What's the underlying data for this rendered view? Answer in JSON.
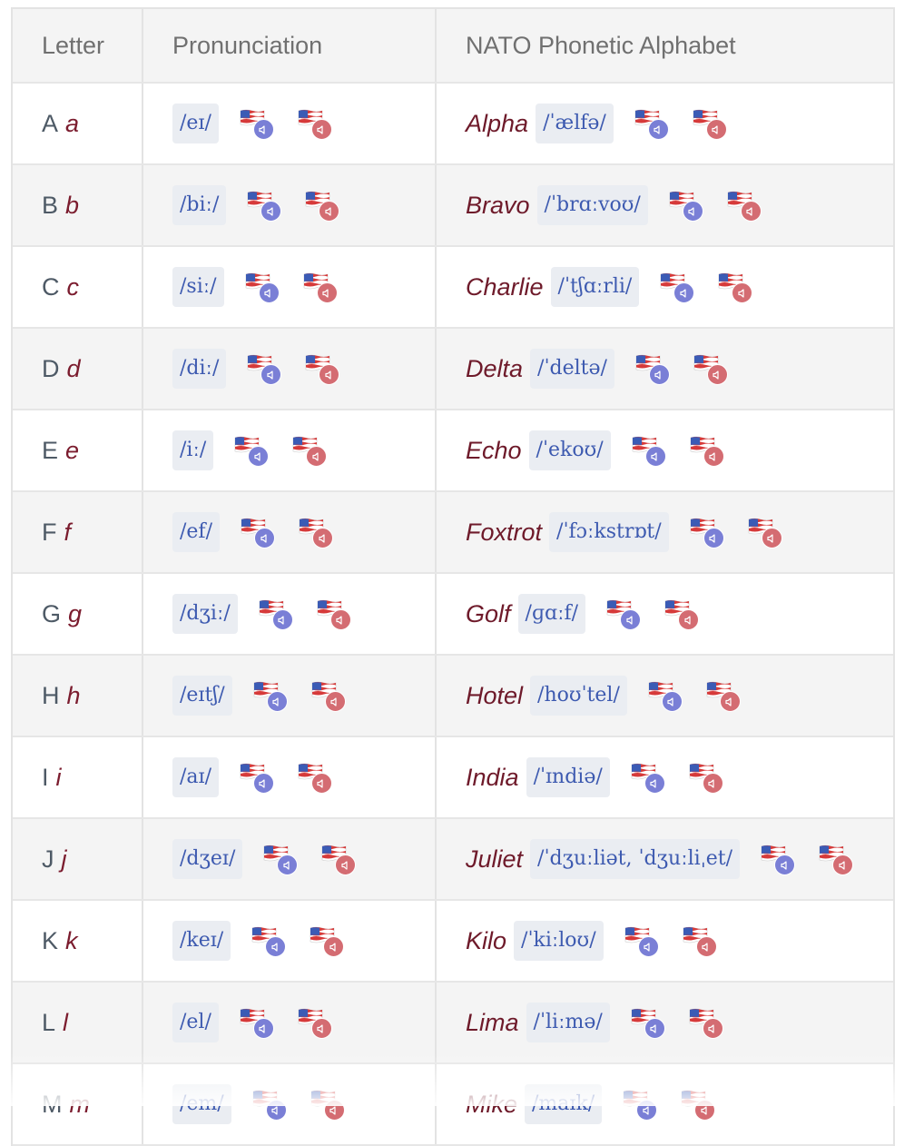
{
  "header": {
    "col_letter": "Letter",
    "col_pronunciation": "Pronunciation",
    "col_nato": "NATO Phonetic Alphabet"
  },
  "rows": [
    {
      "upper": "A",
      "lower": "a",
      "ipa": "/eɪ/",
      "word": "Alpha",
      "word_ipa": "/ˈælfə/"
    },
    {
      "upper": "B",
      "lower": "b",
      "ipa": "/biː/",
      "word": "Bravo",
      "word_ipa": "/ˈbrɑːvoʊ/"
    },
    {
      "upper": "C",
      "lower": "c",
      "ipa": "/siː/",
      "word": "Charlie",
      "word_ipa": "/ˈtʃɑːrli/"
    },
    {
      "upper": "D",
      "lower": "d",
      "ipa": "/diː/",
      "word": "Delta",
      "word_ipa": "/ˈdeltə/"
    },
    {
      "upper": "E",
      "lower": "e",
      "ipa": "/iː/",
      "word": "Echo",
      "word_ipa": "/ˈekoʊ/"
    },
    {
      "upper": "F",
      "lower": "f",
      "ipa": "/ef/",
      "word": "Foxtrot",
      "word_ipa": "/ˈfɔːkstrɒt/"
    },
    {
      "upper": "G",
      "lower": "g",
      "ipa": "/dʒiː/",
      "word": "Golf",
      "word_ipa": "/ɡɑːf/"
    },
    {
      "upper": "H",
      "lower": "h",
      "ipa": "/eɪtʃ/",
      "word": "Hotel",
      "word_ipa": "/hoʊˈtel/"
    },
    {
      "upper": "I",
      "lower": "i",
      "ipa": "/aɪ/",
      "word": "India",
      "word_ipa": "/ˈɪndiə/"
    },
    {
      "upper": "J",
      "lower": "j",
      "ipa": "/dʒeɪ/",
      "word": "Juliet",
      "word_ipa": "/ˈdʒuːliət, ˈdʒuːliˌet/"
    },
    {
      "upper": "K",
      "lower": "k",
      "ipa": "/keɪ/",
      "word": "Kilo",
      "word_ipa": "/ˈkiːloʊ/"
    },
    {
      "upper": "L",
      "lower": "l",
      "ipa": "/el/",
      "word": "Lima",
      "word_ipa": "/ˈliːmə/"
    },
    {
      "upper": "M",
      "lower": "m",
      "ipa": "/em/",
      "word": "Mike",
      "word_ipa": "/maɪk/"
    }
  ],
  "icons": {
    "flag": "us-flag-icon",
    "speaker": "speaker-icon",
    "accent_uk_color": "#7a7fd6",
    "accent_us_color": "#d46c72"
  }
}
